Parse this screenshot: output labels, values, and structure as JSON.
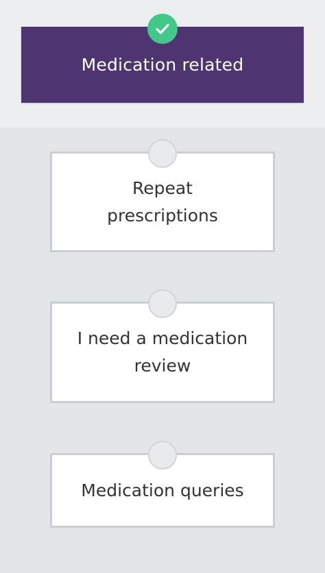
{
  "selected": {
    "label": "Medication related",
    "icon": "check-icon",
    "background_color": "#4f3472",
    "badge_color": "#42c98a"
  },
  "options": [
    {
      "label": "Repeat prescriptions"
    },
    {
      "label": "I need a medication review"
    },
    {
      "label": "Medication queries"
    }
  ]
}
